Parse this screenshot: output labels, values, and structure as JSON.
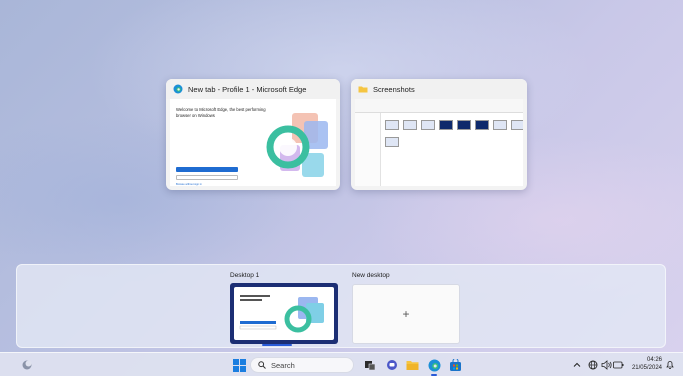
{
  "windows": {
    "edge": {
      "title": "New tab - Profile 1 - Microsoft Edge",
      "welcome": "Welcome to Microsoft Edge, the best performing browser on Windows",
      "link": "Browse without sign in"
    },
    "explorer": {
      "title": "Screenshots"
    }
  },
  "desktops": {
    "current_label": "Desktop 1",
    "new_label": "New desktop",
    "new_plus": "+"
  },
  "taskbar": {
    "search_placeholder": "Search",
    "time": "04:26",
    "date": "21/05/2024"
  },
  "colors": {
    "accent": "#2a5bd7",
    "edge_blue": "#1f6cd1",
    "folder_yellow": "#f5c542",
    "store_blue": "#1a73c9"
  }
}
